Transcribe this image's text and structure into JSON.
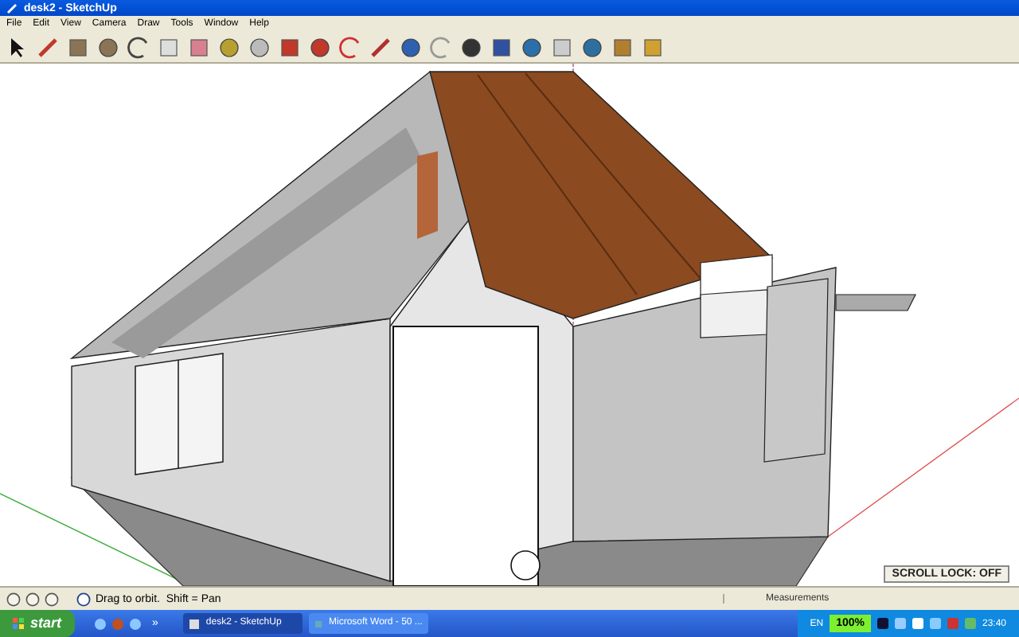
{
  "window": {
    "title": "desk2 - SketchUp"
  },
  "menu": [
    "File",
    "Edit",
    "View",
    "Camera",
    "Draw",
    "Tools",
    "Window",
    "Help"
  ],
  "status_bar": {
    "hint": "Drag to orbit.  Shift = Pan",
    "measurements_label": "Measurements"
  },
  "scroll_lock": "SCROLL LOCK: OFF",
  "taskbar": {
    "start": "start",
    "quick_launch_more": "»",
    "tasks": [
      {
        "label": "desk2 - SketchUp",
        "selected": true
      },
      {
        "label": "Microsoft Word - 50 ...",
        "selected": false
      }
    ],
    "tray": {
      "language": "EN",
      "battery": "100%",
      "clock": "23:40"
    }
  }
}
